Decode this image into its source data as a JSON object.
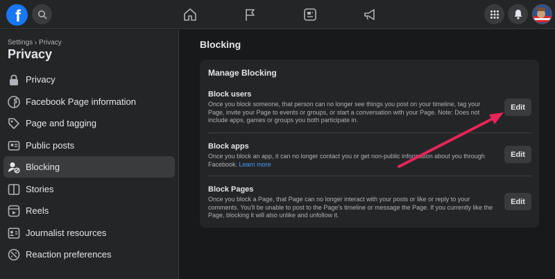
{
  "topbar": {
    "logo_letter": "f",
    "icons": [
      "search-icon",
      "home-icon",
      "flag-icon",
      "news-icon",
      "megaphone-icon",
      "menu-grid-icon",
      "bell-icon"
    ]
  },
  "sidebar": {
    "breadcrumb": "Settings › Privacy",
    "title": "Privacy",
    "items": [
      {
        "label": "Privacy",
        "icon": "lock-icon"
      },
      {
        "label": "Facebook Page information",
        "icon": "facebook-icon"
      },
      {
        "label": "Page and tagging",
        "icon": "tag-icon"
      },
      {
        "label": "Public posts",
        "icon": "public-posts-icon"
      },
      {
        "label": "Blocking",
        "icon": "block-user-icon"
      },
      {
        "label": "Stories",
        "icon": "stories-icon"
      },
      {
        "label": "Reels",
        "icon": "reels-icon"
      },
      {
        "label": "Journalist resources",
        "icon": "journalist-icon"
      },
      {
        "label": "Reaction preferences",
        "icon": "reaction-icon"
      }
    ]
  },
  "main": {
    "title": "Blocking",
    "card_title": "Manage Blocking",
    "sections": [
      {
        "title": "Block users",
        "description": "Once you block someone, that person can no longer see things you post on your timeline, tag your Page, invite your Page to events or groups, or start a conversation with your Page. Note: Does not include apps, games or groups you both participate in.",
        "button": "Edit"
      },
      {
        "title": "Block apps",
        "description": "Once you block an app, it can no longer contact you or get non-public information about you through Facebook.",
        "link": "Learn more",
        "button": "Edit"
      },
      {
        "title": "Block Pages",
        "description": "Once you block a Page, that Page can no longer interact with your posts or like or reply to your comments. You'll be unable to post to the Page's timeline or message the Page. If you currently like the Page, blocking it will also unlike and unfollow it.",
        "button": "Edit"
      }
    ]
  },
  "colors": {
    "accent": "#1877f2",
    "annotation_arrow": "#e8245a",
    "link": "#4599ff"
  }
}
